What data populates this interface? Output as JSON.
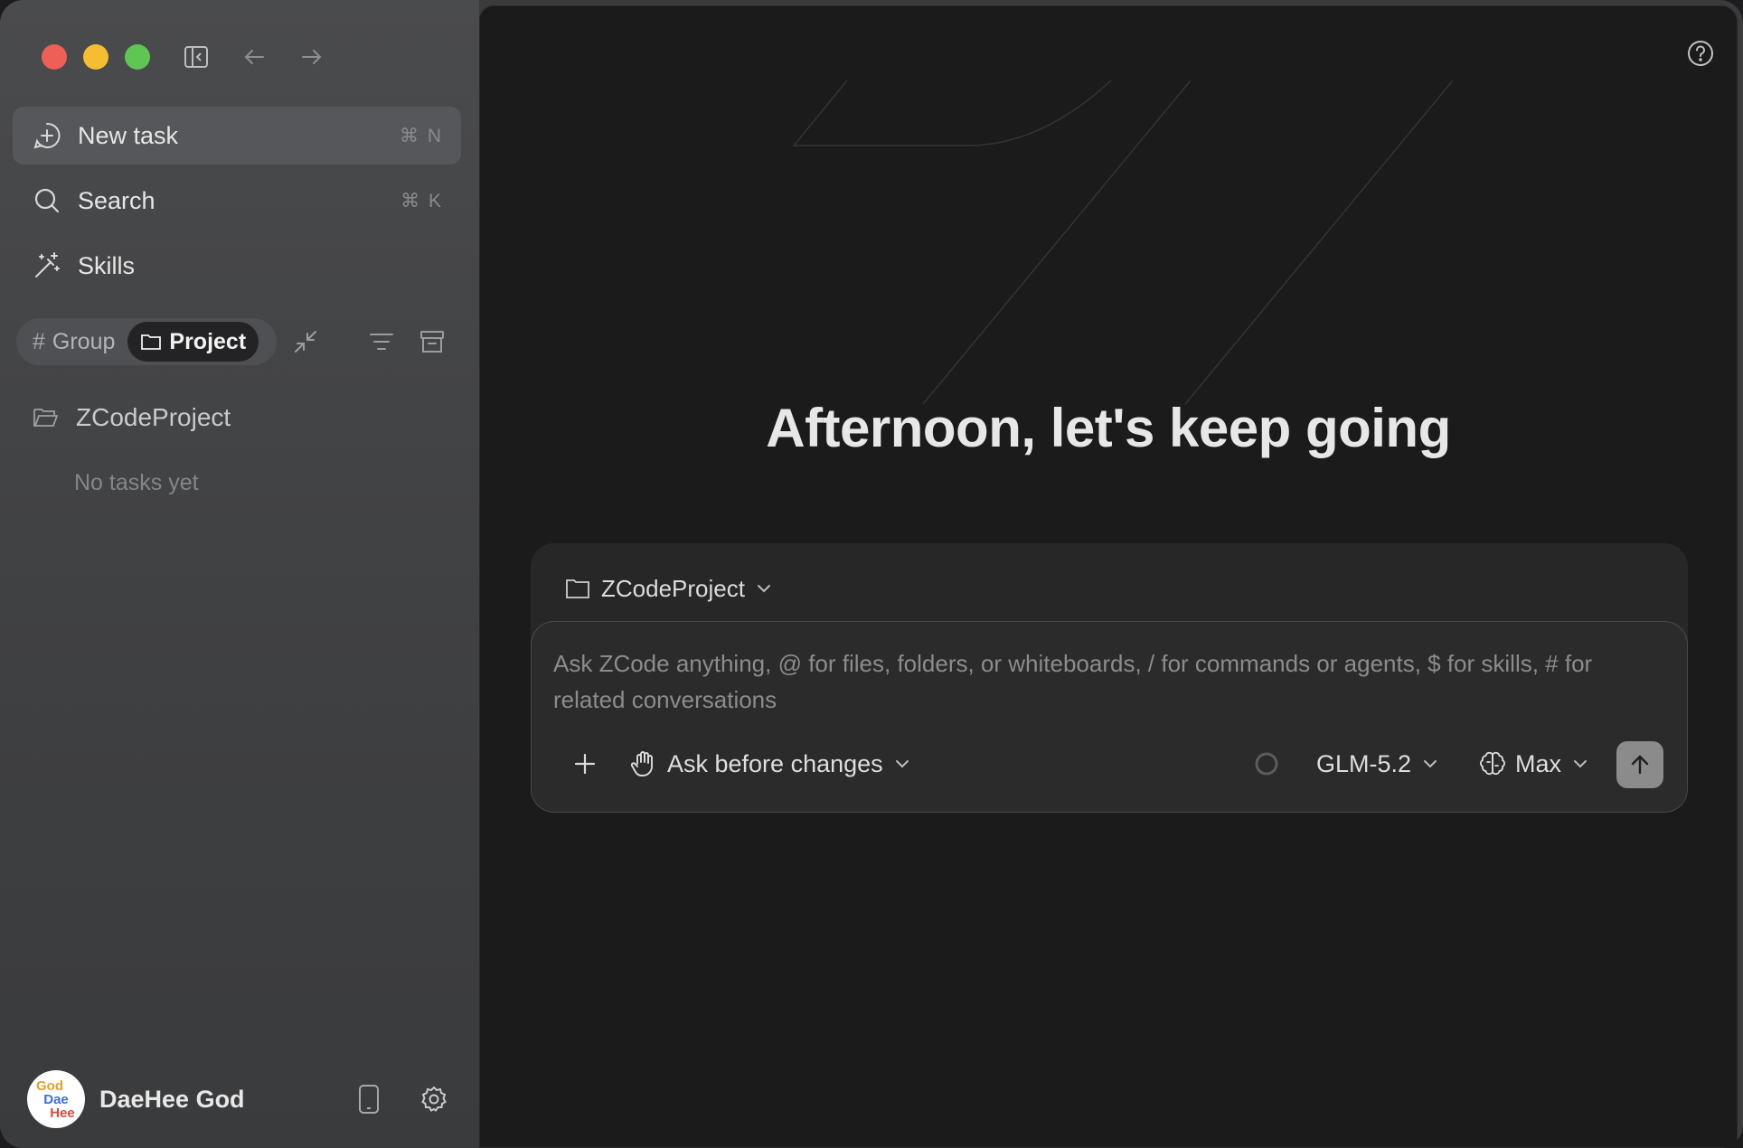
{
  "sidebar": {
    "nav": [
      {
        "label": "New task",
        "shortcut": "⌘ N"
      },
      {
        "label": "Search",
        "shortcut": "⌘ K"
      },
      {
        "label": "Skills"
      }
    ],
    "view_toggle": {
      "group_label": "Group",
      "project_label": "Project",
      "selected": "Project"
    },
    "project": {
      "name": "ZCodeProject",
      "empty_text": "No tasks yet"
    },
    "user": {
      "name": "DaeHee God",
      "avatar_text": [
        "God",
        "Dae",
        "Hee"
      ]
    }
  },
  "main": {
    "greeting": "Afternoon, let's keep going",
    "composer": {
      "project": "ZCodeProject",
      "placeholder": "Ask ZCode anything, @ for files, folders, or whiteboards, / for commands or agents, $ for skills, # for related conversations",
      "mode": "Ask before changes",
      "model": "GLM-5.2",
      "effort": "Max"
    }
  },
  "colors": {
    "sidebar_bg": "#434446",
    "main_bg": "#1b1b1b",
    "send_button": "#8b8b8b",
    "traffic_red": "#ed5f57",
    "traffic_yellow": "#f5bd30",
    "traffic_green": "#5fc553"
  }
}
